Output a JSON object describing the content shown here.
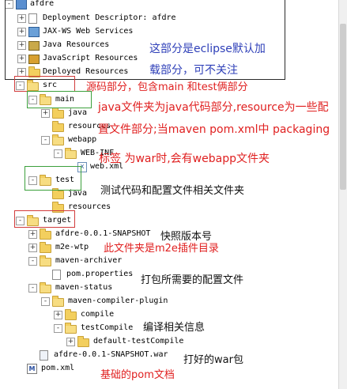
{
  "tree": [
    {
      "label": "afdre",
      "icon": "project-icon",
      "toggle": "-"
    },
    {
      "label": "Deployment Descriptor: afdre",
      "icon": "deployment-descriptor-icon",
      "toggle": "+"
    },
    {
      "label": "JAX-WS Web Services",
      "icon": "web-services-icon",
      "toggle": "+"
    },
    {
      "label": "Java Resources",
      "icon": "java-resources-icon",
      "toggle": "+"
    },
    {
      "label": "JavaScript Resources",
      "icon": "javascript-resources-icon",
      "toggle": "+"
    },
    {
      "label": "Deployed Resources",
      "icon": "deployed-resources-icon",
      "toggle": "+"
    },
    {
      "label": "src",
      "icon": "folder-icon",
      "toggle": "-"
    },
    {
      "label": "main",
      "icon": "folder-icon",
      "toggle": "-"
    },
    {
      "label": "java",
      "icon": "folder-icon",
      "toggle": "+"
    },
    {
      "label": "resources",
      "icon": "folder-icon",
      "toggle": ""
    },
    {
      "label": "webapp",
      "icon": "folder-icon",
      "toggle": "-"
    },
    {
      "label": "WEB-INF",
      "icon": "folder-icon",
      "toggle": "-"
    },
    {
      "label": "web.xml",
      "icon": "xml-file-icon",
      "toggle": ""
    },
    {
      "label": "test",
      "icon": "folder-icon",
      "toggle": "-"
    },
    {
      "label": "java",
      "icon": "folder-icon",
      "toggle": ""
    },
    {
      "label": "resources",
      "icon": "folder-icon",
      "toggle": ""
    },
    {
      "label": "target",
      "icon": "folder-icon",
      "toggle": "-"
    },
    {
      "label": "afdre-0.0.1-SNAPSHOT",
      "icon": "folder-icon",
      "toggle": "+"
    },
    {
      "label": "m2e-wtp",
      "icon": "folder-icon",
      "toggle": "+"
    },
    {
      "label": "maven-archiver",
      "icon": "folder-icon",
      "toggle": "-"
    },
    {
      "label": "pom.properties",
      "icon": "file-icon",
      "toggle": ""
    },
    {
      "label": "maven-status",
      "icon": "folder-icon",
      "toggle": "-"
    },
    {
      "label": "maven-compiler-plugin",
      "icon": "folder-icon",
      "toggle": "-"
    },
    {
      "label": "compile",
      "icon": "folder-icon",
      "toggle": "+"
    },
    {
      "label": "testCompile",
      "icon": "folder-icon",
      "toggle": "-"
    },
    {
      "label": "default-testCompile",
      "icon": "folder-icon",
      "toggle": "+"
    },
    {
      "label": "afdre-0.0.1-SNAPSHOT.war",
      "icon": "war-file-icon",
      "toggle": ""
    },
    {
      "label": "pom.xml",
      "icon": "pom-file-icon",
      "toggle": ""
    }
  ],
  "annotations": {
    "eclipse_default_1": "这部分是eclipse默认加",
    "eclipse_default_2": "载部分，可不关注",
    "src_note": "源码部分，包含main 和test俩部分",
    "main_note_1": "java文件夹为java代码部分,resource为一些配",
    "main_note_2": "置文件部分;当maven pom.xml中 packaging",
    "main_note_3": "标签 为war时,会有webapp文件夹",
    "test_note": "测试代码和配置文件相关文件夹",
    "snapshot_note": "快照版本号",
    "m2e_note": "此文件夹是m2e插件目录",
    "archiver_note": "打包所需要的配置文件",
    "compile_note": "编译相关信息",
    "war_note": "打好的war包",
    "pom_note": "基础的pom文档"
  },
  "colors": {
    "annotation_blue": "#2e3fb8",
    "annotation_red": "#e02020",
    "box_red": "#d23c3c",
    "box_green": "#3ca03c"
  }
}
